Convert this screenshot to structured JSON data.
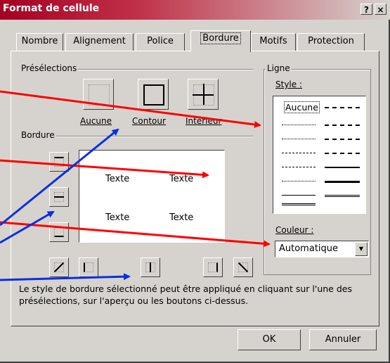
{
  "window": {
    "title": "Format de cellule",
    "help_glyph": "?",
    "close_glyph": "×"
  },
  "tabs": [
    {
      "label": "Nombre"
    },
    {
      "label": "Alignement"
    },
    {
      "label": "Police"
    },
    {
      "label": "Bordure",
      "active": true
    },
    {
      "label": "Motifs"
    },
    {
      "label": "Protection"
    }
  ],
  "presets": {
    "group_label": "Présélections",
    "items": [
      {
        "label": "Aucune"
      },
      {
        "label": "Contour"
      },
      {
        "label": "Intérieur"
      }
    ]
  },
  "border": {
    "group_label": "Bordure",
    "preview_text": [
      "Texte",
      "Texte",
      "Texte",
      "Texte"
    ]
  },
  "line": {
    "group_label": "Ligne",
    "style_label": "Style :",
    "style_none": "Aucune",
    "color_label": "Couleur :",
    "color_value": "Automatique"
  },
  "info_text": "Le style de bordure sélectionné peut être appliqué en cliquant sur l'une des présélections, sur l'aperçu ou les boutons ci-dessus.",
  "buttons": {
    "ok": "OK",
    "cancel": "Annuler"
  },
  "colors": {
    "title_bar": "#a50021",
    "dialog_bg": "#d6d3ce",
    "arrow_red": "#ff0000",
    "arrow_blue": "#0a2fe0"
  }
}
